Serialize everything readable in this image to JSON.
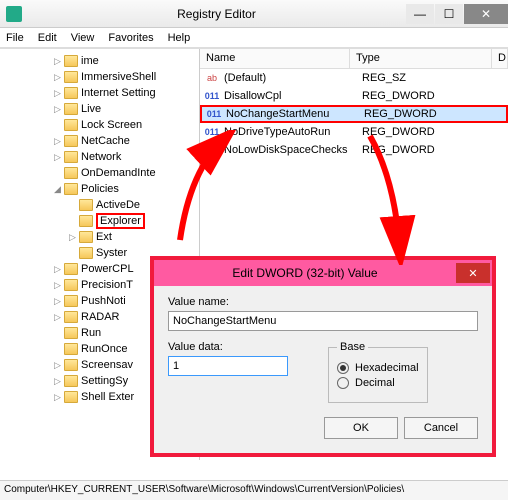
{
  "window": {
    "title": "Registry Editor"
  },
  "menus": {
    "file": "File",
    "edit": "Edit",
    "view": "View",
    "favorites": "Favorites",
    "help": "Help"
  },
  "tree": [
    {
      "label": "ime",
      "indent": 1,
      "tw": "▷"
    },
    {
      "label": "ImmersiveShell",
      "indent": 1,
      "tw": "▷"
    },
    {
      "label": "Internet Setting",
      "indent": 1,
      "tw": "▷"
    },
    {
      "label": "Live",
      "indent": 1,
      "tw": "▷"
    },
    {
      "label": "Lock Screen",
      "indent": 1,
      "tw": ""
    },
    {
      "label": "NetCache",
      "indent": 1,
      "tw": "▷"
    },
    {
      "label": "Network",
      "indent": 1,
      "tw": "▷"
    },
    {
      "label": "OnDemandInte",
      "indent": 1,
      "tw": ""
    },
    {
      "label": "Policies",
      "indent": 1,
      "tw": "◢"
    },
    {
      "label": "ActiveDe",
      "indent": 2,
      "tw": ""
    },
    {
      "label": "Explorer",
      "indent": 2,
      "tw": "",
      "hl": true
    },
    {
      "label": "Ext",
      "indent": 2,
      "tw": "▷"
    },
    {
      "label": "Syster",
      "indent": 2,
      "tw": ""
    },
    {
      "label": "PowerCPL",
      "indent": 1,
      "tw": "▷"
    },
    {
      "label": "PrecisionT",
      "indent": 1,
      "tw": "▷"
    },
    {
      "label": "PushNoti",
      "indent": 1,
      "tw": "▷"
    },
    {
      "label": "RADAR",
      "indent": 1,
      "tw": "▷"
    },
    {
      "label": "Run",
      "indent": 1,
      "tw": ""
    },
    {
      "label": "RunOnce",
      "indent": 1,
      "tw": ""
    },
    {
      "label": "Screensav",
      "indent": 1,
      "tw": "▷"
    },
    {
      "label": "SettingSy",
      "indent": 1,
      "tw": "▷"
    },
    {
      "label": "Shell Exter",
      "indent": 1,
      "tw": "▷"
    }
  ],
  "list": {
    "headers": {
      "name": "Name",
      "type": "Type",
      "data": "D"
    },
    "rows": [
      {
        "name": "(Default)",
        "type": "REG_SZ",
        "kind": "str"
      },
      {
        "name": "DisallowCpl",
        "type": "REG_DWORD",
        "kind": "dw"
      },
      {
        "name": "NoChangeStartMenu",
        "type": "REG_DWORD",
        "kind": "dw",
        "sel": true,
        "box": true
      },
      {
        "name": "NoDriveTypeAutoRun",
        "type": "REG_DWORD",
        "kind": "dw"
      },
      {
        "name": "NoLowDiskSpaceChecks",
        "type": "REG_DWORD",
        "kind": "dw"
      }
    ]
  },
  "dialog": {
    "title": "Edit DWORD (32-bit) Value",
    "value_name_label": "Value name:",
    "value_name": "NoChangeStartMenu",
    "value_data_label": "Value data:",
    "value_data": "1",
    "base_label": "Base",
    "hex_label": "Hexadecimal",
    "dec_label": "Decimal",
    "base_selected": "hex",
    "ok": "OK",
    "cancel": "Cancel"
  },
  "status": "Computer\\HKEY_CURRENT_USER\\Software\\Microsoft\\Windows\\CurrentVersion\\Policies\\"
}
